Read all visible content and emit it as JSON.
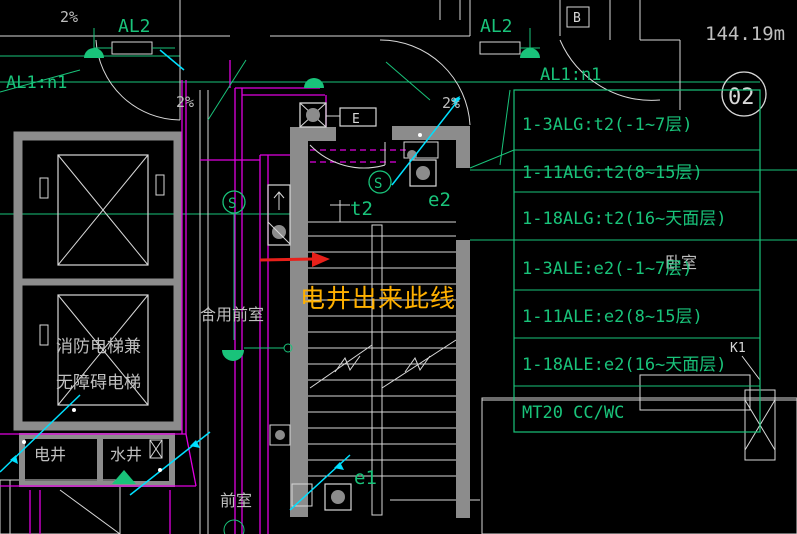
{
  "drawing": {
    "top_labels": {
      "al2_left": "AL2",
      "al2_right": "AL2",
      "box_b": "B",
      "dim": "144.19m",
      "slope_top": "2%"
    },
    "al1_left": "AL1:n1",
    "al1_right": "AL1:n1",
    "slope_mid": "2%",
    "slope_right": "2%",
    "axis_bubble": "02",
    "box_e": "E",
    "s_symbol": "S",
    "t2_label": "t2",
    "e2_label": "e2",
    "e1_label": "e1",
    "shared_front_room": "合用前室",
    "front_room": "前室",
    "elevator_note_1": "消防电梯兼",
    "elevator_note_2": "无障碍电梯",
    "elec_shaft": "电井",
    "water_shaft": "水井",
    "room_partial": "卧室",
    "k1_label": "K1"
  },
  "legend_table": {
    "rows": [
      "1-3ALG:t2(-1~7层)",
      "1-11ALG:t2(8~15层)",
      "1-18ALG:t2(16~天面层)",
      "1-3ALE:e2(-1~7层)",
      "1-11ALE:e2(8~15层)",
      "1-18ALE:e2(16~天面层)",
      "MT20 CC/WC"
    ]
  },
  "annotation": {
    "note": "电井出来此线",
    "arrow_color": "#e8201a",
    "note_color": "#ffb000"
  },
  "colors": {
    "background": "#000000",
    "wall": "#8c8c8c",
    "cyan_line": "#00e0ff",
    "magenta_line": "#e000e0",
    "green_line": "#19c37a",
    "white_line": "#e6e6e6",
    "text_gray": "#bfbfbf"
  }
}
